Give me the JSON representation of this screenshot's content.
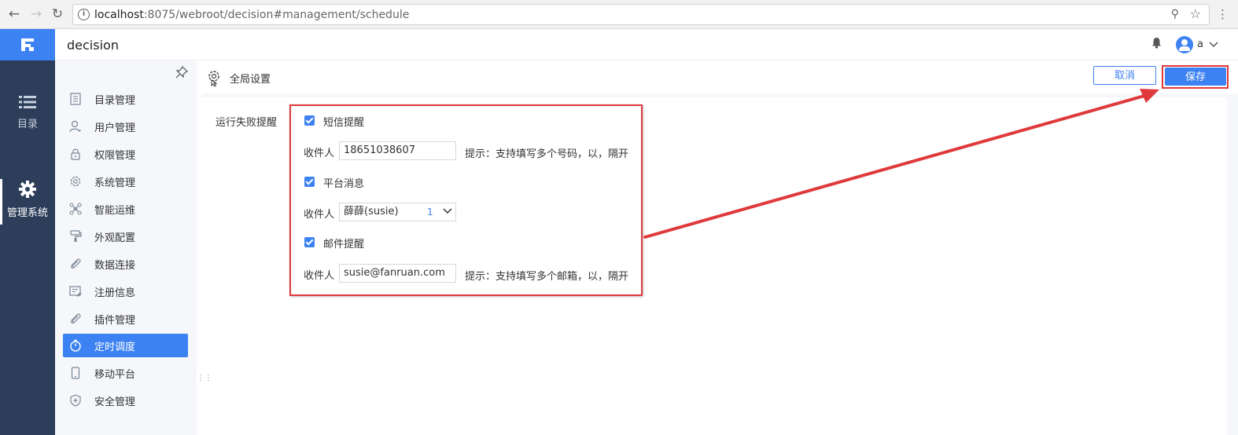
{
  "browser": {
    "url_host": "localhost",
    "url_rest": ":8075/webroot/decision#management/schedule",
    "back_icon": "arrow-left-icon",
    "forward_icon": "arrow-right-icon",
    "reload_icon": "reload-icon"
  },
  "app": {
    "title": "decision",
    "user_name": "a",
    "brand_color": "#3d82f2",
    "rail_color": "#2c3e5a",
    "highlight_color": "#e0393b"
  },
  "rail": {
    "items": [
      {
        "label": "目录",
        "icon": "list-icon"
      },
      {
        "label": "管理系统",
        "icon": "gear-icon"
      }
    ]
  },
  "sidebar": {
    "items": [
      {
        "label": "目录管理",
        "icon": "catalog-icon"
      },
      {
        "label": "用户管理",
        "icon": "user-icon"
      },
      {
        "label": "权限管理",
        "icon": "lock-icon"
      },
      {
        "label": "系统管理",
        "icon": "settings-icon"
      },
      {
        "label": "智能运维",
        "icon": "ops-icon"
      },
      {
        "label": "外观配置",
        "icon": "paint-roller-icon"
      },
      {
        "label": "数据连接",
        "icon": "paperclip-icon"
      },
      {
        "label": "注册信息",
        "icon": "register-icon"
      },
      {
        "label": "插件管理",
        "icon": "plugin-icon"
      },
      {
        "label": "定时调度",
        "icon": "timer-icon",
        "active": true
      },
      {
        "label": "移动平台",
        "icon": "mobile-icon"
      },
      {
        "label": "安全管理",
        "icon": "shield-icon"
      }
    ]
  },
  "main": {
    "breadcrumb": "全局设置",
    "cancel_label": "取消",
    "save_label": "保存",
    "field_label": "运行失败提醒",
    "sms": {
      "label": "短信提醒",
      "recipient_label": "收件人",
      "value": "18651038607",
      "hint": "提示：支持填写多个号码，以，隔开"
    },
    "platform": {
      "label": "平台消息",
      "recipient_label": "收件人",
      "value": "薛薛(susie)",
      "count": "1"
    },
    "email": {
      "label": "邮件提醒",
      "recipient_label": "收件人",
      "value": "susie@fanruan.com",
      "hint": "提示：支持填写多个邮箱，以，隔开"
    }
  }
}
